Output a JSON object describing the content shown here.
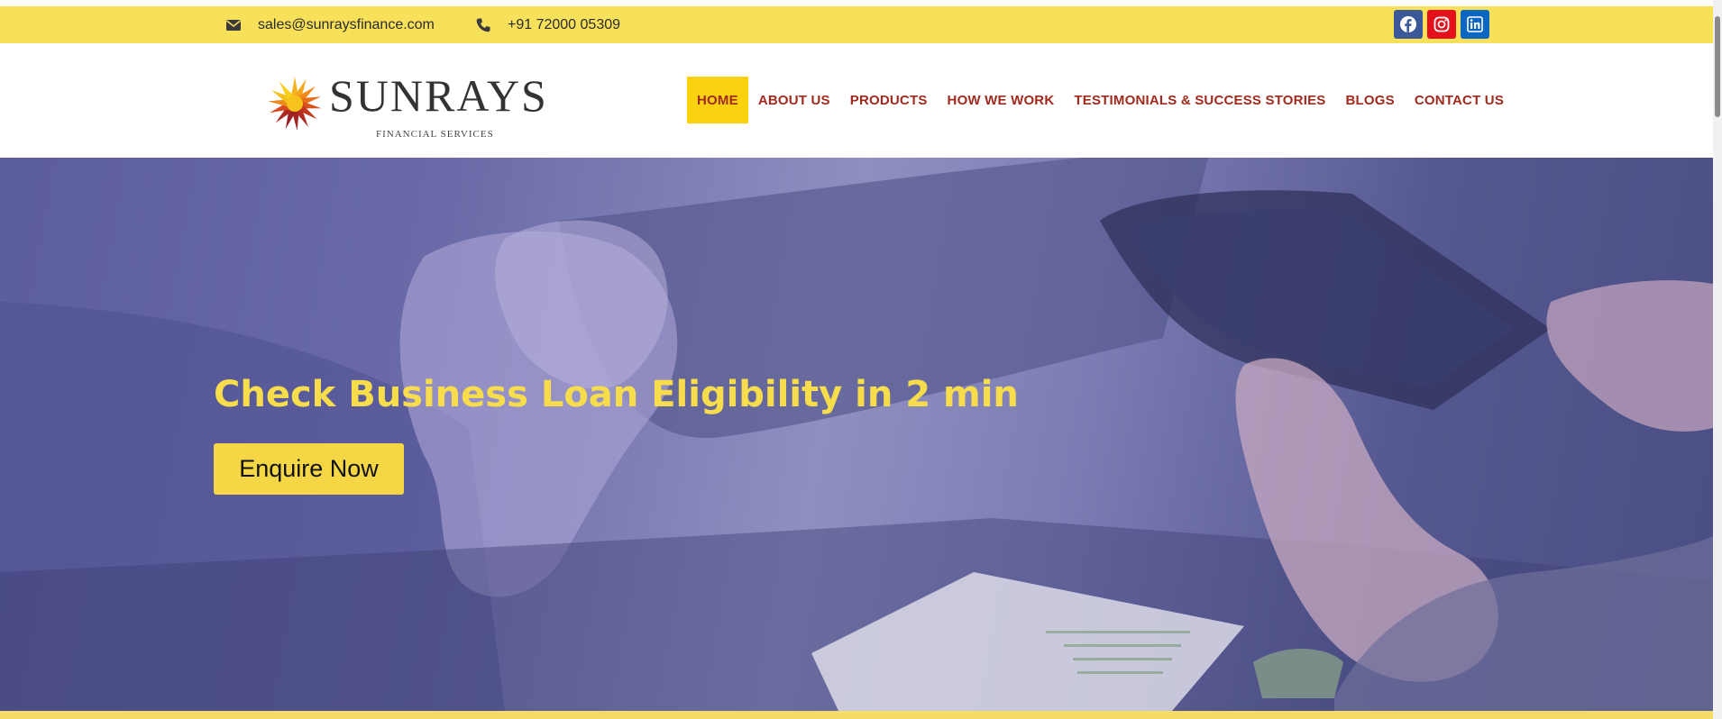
{
  "topbar": {
    "email": "sales@sunraysfinance.com",
    "phone": "+91 72000 05309",
    "email_icon": "envelope-icon",
    "phone_icon": "phone-icon",
    "social": [
      {
        "name": "facebook-icon",
        "color": "#3b5998"
      },
      {
        "name": "instagram-icon",
        "color": "#e4111c"
      },
      {
        "name": "linkedin-icon",
        "color": "#0a66c2"
      }
    ],
    "background": "#f7e05a"
  },
  "logo": {
    "wordmark": "SUNRAYS",
    "subtitle": "FINANCIAL SERVICES",
    "icon": "sunburst-logo-icon"
  },
  "nav": {
    "items": [
      {
        "label": "HOME",
        "active": true
      },
      {
        "label": "ABOUT US",
        "active": false
      },
      {
        "label": "PRODUCTS",
        "active": false
      },
      {
        "label": "HOW WE WORK",
        "active": false
      },
      {
        "label": "TESTIMONIALS & SUCCESS STORIES",
        "active": false
      },
      {
        "label": "BLOGS",
        "active": false
      },
      {
        "label": "CONTACT US",
        "active": false
      }
    ],
    "text_color": "#a02a1e",
    "active_bg": "#fbd20f"
  },
  "hero": {
    "title": "Check Business Loan Eligibility in 2 min",
    "cta_label": "Enquire Now",
    "title_color": "#f7dd4c",
    "cta_bg": "#f5d745",
    "overlay_color": "#6a6aa8"
  }
}
